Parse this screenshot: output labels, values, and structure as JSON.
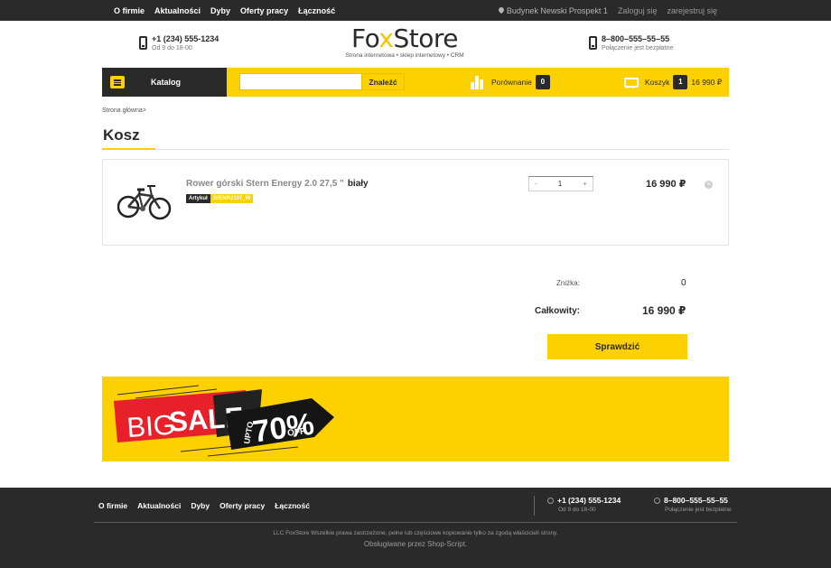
{
  "topbar": {
    "nav": [
      "O firmie",
      "Aktualności",
      "Dyby",
      "Oferty pracy",
      "Łączność"
    ],
    "address": "Budynek Newski Prospekt 1",
    "login": "Zaloguj się",
    "register": "zarejestruj się"
  },
  "header": {
    "phone_left": {
      "number": "+1 (234) 555-1234",
      "hours": "Od 9 do 18-00"
    },
    "logo": {
      "part1": "Fo",
      "part2": "x",
      "part3": "Store",
      "tagline": "Strona internetowa • sklep internetowy • CRM"
    },
    "phone_right": {
      "number": "8–800–555–55–55",
      "note": "Połączenie jest bezpłatne"
    }
  },
  "navbar": {
    "catalog_label": "Katalog",
    "search_placeholder": "",
    "search_button": "Znaleźć",
    "compare_label": "Porównanie",
    "compare_count": "0",
    "cart_label": "Koszyk",
    "cart_count": "1",
    "cart_total": "16 990 ₽"
  },
  "breadcrumb": "Strona główna>",
  "page_title": "Kosz",
  "cart_item": {
    "name": "Rower górski Stern Energy 2.0 27,5 \"",
    "color": "biały",
    "sku_label": "Artykuł",
    "sku_value": "20ENR2107_W",
    "quantity": "1",
    "minus": "-",
    "plus": "+",
    "price": "16 990 ₽",
    "remove": "×"
  },
  "totals": {
    "discount_label": "Zniżka:",
    "discount_value": "0",
    "total_label": "Całkowity:",
    "total_value": "16 990 ₽",
    "checkout_button": "Sprawdzić"
  },
  "banner": {
    "big": "BIG",
    "sale": "SALE",
    "upto": "UPTO",
    "percent": "70%",
    "off": "OFF"
  },
  "footer": {
    "nav": [
      "O firmie",
      "Aktualności",
      "Dyby",
      "Oferty pracy",
      "Łączność"
    ],
    "phone1": {
      "number": "+1 (234) 555-1234",
      "hours": "Od 9 do 18-00"
    },
    "phone2": {
      "number": "8–800–555–55–55",
      "note": "Połączenie jest bezpłatne"
    },
    "copyright": "LLC FoxStore Wszelkie prawa zastrzeżone, pełne lub częściowe kopiowanie tylko za zgodą właścicieli strony.",
    "powered": "Obsługiwane przez Shop-Script."
  },
  "colors": {
    "accent": "#fdd000",
    "dark": "#2a2a2a"
  }
}
